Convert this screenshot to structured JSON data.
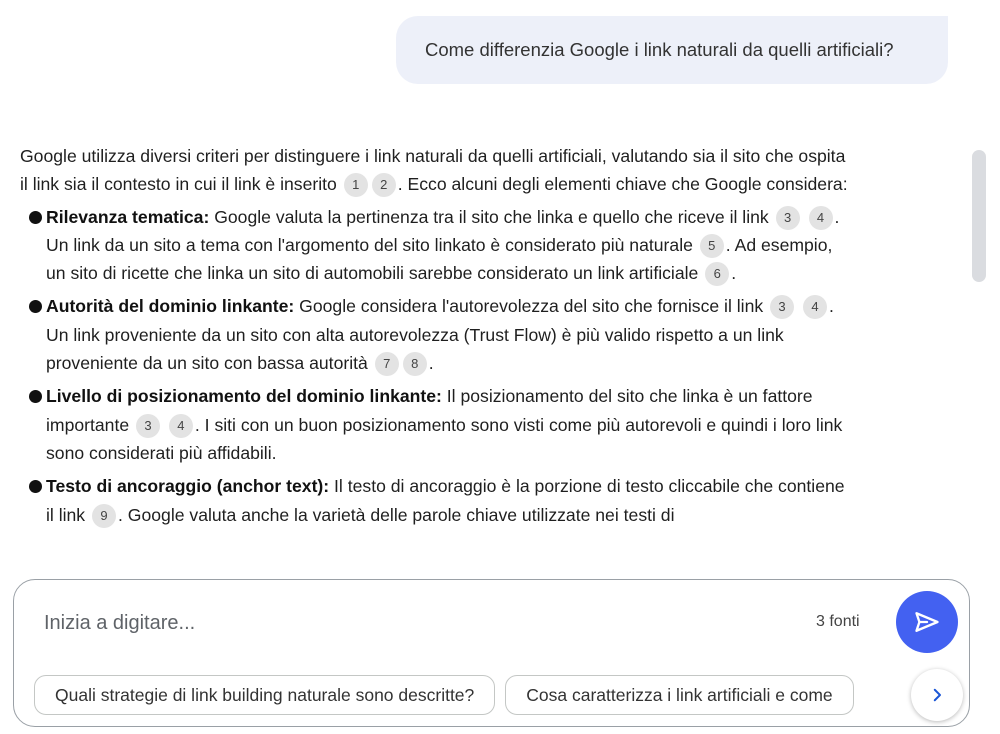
{
  "user_message": "Come differenzia Google i link naturali da quelli artificiali?",
  "answer": {
    "intro": {
      "part1": "Google utilizza diversi criteri per distinguere i link naturali da quelli artificiali, valutando sia il sito che ospita il link sia il contesto in cui il link è inserito",
      "cite1": "1",
      "cite2": "2",
      "part2": ". Ecco alcuni degli elementi chiave che Google considera:"
    },
    "items": [
      {
        "title": "Rilevanza tematica:",
        "t1": " Google valuta la pertinenza tra il sito che linka e quello che riceve il link",
        "c1": "3",
        "c2": "4",
        "t2": ". Un link da un sito a tema con l'argomento del sito linkato è considerato più naturale",
        "c3": "5",
        "t3": ". Ad esempio, un sito di ricette che linka un sito di automobili sarebbe considerato un link artificiale",
        "c4": "6",
        "t4": "."
      },
      {
        "title": "Autorità del dominio linkante:",
        "t1": " Google considera l'autorevolezza del sito che fornisce il link",
        "c1": "3",
        "c2": "4",
        "t2": ". Un link proveniente da un sito con alta autorevolezza (Trust Flow) è più valido rispetto a un link proveniente da un sito con bassa autorità",
        "c3": "7",
        "c4": "8",
        "t3": "."
      },
      {
        "title": "Livello di posizionamento del dominio linkante:",
        "t1": " Il posizionamento del sito che linka è un fattore importante",
        "c1": "3",
        "c2": "4",
        "t2": ". I siti con un buon posizionamento sono visti come più autorevoli e quindi i loro link sono considerati più affidabili."
      },
      {
        "title": "Testo di ancoraggio (anchor text):",
        "t1": " Il testo di ancoraggio è la porzione di testo cliccabile che contiene il link",
        "c1": "9",
        "t2": ". Google valuta anche la varietà delle parole chiave utilizzate nei testi di"
      }
    ]
  },
  "input": {
    "placeholder": "Inizia a digitare...",
    "value": "",
    "sources_label": "3 fonti"
  },
  "suggestions": [
    "Quali strategie di link building naturale sono descritte?",
    "Cosa caratterizza i link artificiali e come"
  ],
  "icons": {
    "send": "send-icon",
    "next": "chevron-right-icon"
  },
  "colors": {
    "accent": "#4361f1",
    "user_bubble": "#edf0f9",
    "citation_bg": "#e3e3e3"
  }
}
